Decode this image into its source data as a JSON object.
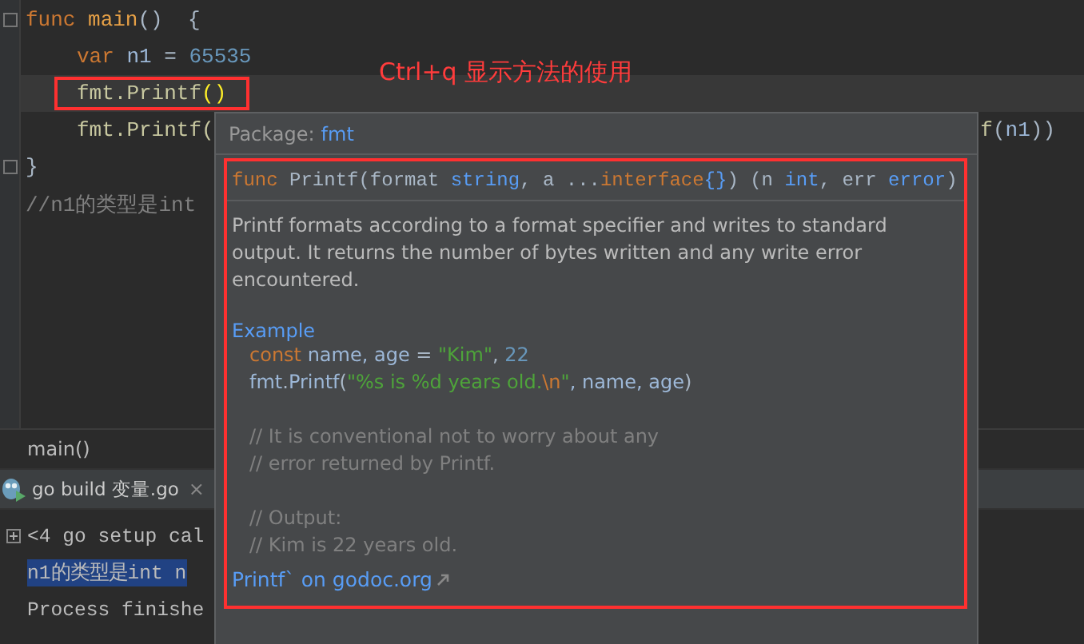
{
  "editor": {
    "lines": [
      {
        "fold": true,
        "indented": false,
        "current": false,
        "boxed": false,
        "tokens": [
          {
            "text": "func",
            "kind": "keyword"
          },
          {
            "text": " main",
            "kind": "funcname"
          },
          {
            "text": "()  {",
            "kind": "plain"
          }
        ]
      },
      {
        "fold": false,
        "indented": true,
        "current": false,
        "boxed": false,
        "tokens": [
          {
            "text": "var",
            "kind": "keyword"
          },
          {
            "text": " n1",
            "kind": "var"
          },
          {
            "text": " = ",
            "kind": "plain"
          },
          {
            "text": "65535",
            "kind": "number"
          }
        ]
      },
      {
        "fold": false,
        "indented": true,
        "current": true,
        "boxed": true,
        "tokens": [
          {
            "text": "fmt.Printf",
            "kind": "call"
          },
          {
            "text": "()",
            "kind": "brace"
          }
        ]
      },
      {
        "fold": false,
        "indented": true,
        "current": false,
        "boxed": false,
        "tokens": [
          {
            "text": "fmt.Printf(",
            "kind": "call"
          }
        ],
        "tail": [
          {
            "text": "f",
            "kind": "call"
          },
          {
            "text": "(",
            "kind": "plain"
          },
          {
            "text": "n1",
            "kind": "var"
          },
          {
            "text": "))",
            "kind": "plain"
          }
        ]
      },
      {
        "fold": true,
        "indented": false,
        "current": false,
        "boxed": false,
        "tokens": [
          {
            "text": "}",
            "kind": "plain"
          }
        ]
      },
      {
        "fold": false,
        "indented": false,
        "current": false,
        "boxed": false,
        "tokens": [
          {
            "text": "//n1的类型是int",
            "kind": "comment"
          }
        ]
      }
    ]
  },
  "annotation": "Ctrl+q  显示方法的使用",
  "breadcrumb": "main()",
  "run_tab": {
    "label": "go build 变量.go",
    "close": "×"
  },
  "console": {
    "lines": [
      {
        "text": "<4 go setup cal",
        "expandable": true,
        "selected": false
      },
      {
        "text": "n1的类型是int n",
        "expandable": false,
        "selected": true
      },
      {
        "text": "Process finishe",
        "expandable": false,
        "selected": false
      }
    ]
  },
  "popup": {
    "package_label": "Package:",
    "package": "fmt",
    "signature": [
      {
        "text": "func",
        "kind": "keyword"
      },
      {
        "text": " Printf(format ",
        "kind": "plain"
      },
      {
        "text": "string",
        "kind": "type"
      },
      {
        "text": ", a ...",
        "kind": "plain"
      },
      {
        "text": "interface",
        "kind": "keyword"
      },
      {
        "text": "{}",
        "kind": "type"
      },
      {
        "text": ") (n ",
        "kind": "plain"
      },
      {
        "text": "int",
        "kind": "type"
      },
      {
        "text": ", err ",
        "kind": "plain"
      },
      {
        "text": "error",
        "kind": "type"
      },
      {
        "text": ")",
        "kind": "plain"
      }
    ],
    "description": "Printf formats according to a format specifier and writes to standard output. It returns the number of bytes written and any write error encountered.",
    "example_heading": "Example",
    "example": [
      {
        "gap": false,
        "tokens": [
          {
            "text": "const",
            "kind": "keyword"
          },
          {
            "text": " name, age",
            "kind": "var"
          },
          {
            "text": " = ",
            "kind": "plain"
          },
          {
            "text": "\"Kim\"",
            "kind": "string"
          },
          {
            "text": ", ",
            "kind": "plain"
          },
          {
            "text": "22",
            "kind": "number"
          }
        ]
      },
      {
        "gap": false,
        "tokens": [
          {
            "text": "fmt",
            "kind": "var"
          },
          {
            "text": ".",
            "kind": "plain"
          },
          {
            "text": "Printf",
            "kind": "var"
          },
          {
            "text": "(",
            "kind": "plain"
          },
          {
            "text": "\"%s is %d years old.",
            "kind": "string"
          },
          {
            "text": "\\n",
            "kind": "keyword"
          },
          {
            "text": "\"",
            "kind": "string"
          },
          {
            "text": ", name, age",
            "kind": "var"
          },
          {
            "text": ")",
            "kind": "plain"
          }
        ]
      },
      {
        "gap": true,
        "tokens": [
          {
            "text": "// It is conventional not to worry about any",
            "kind": "comment"
          }
        ]
      },
      {
        "gap": false,
        "tokens": [
          {
            "text": "// error returned by Printf.",
            "kind": "comment"
          }
        ]
      },
      {
        "gap": true,
        "tokens": [
          {
            "text": "// Output:",
            "kind": "comment"
          }
        ]
      },
      {
        "gap": false,
        "tokens": [
          {
            "text": "// Kim is 22 years old.",
            "kind": "comment"
          }
        ]
      }
    ],
    "link": "Printf` on godoc.org"
  }
}
